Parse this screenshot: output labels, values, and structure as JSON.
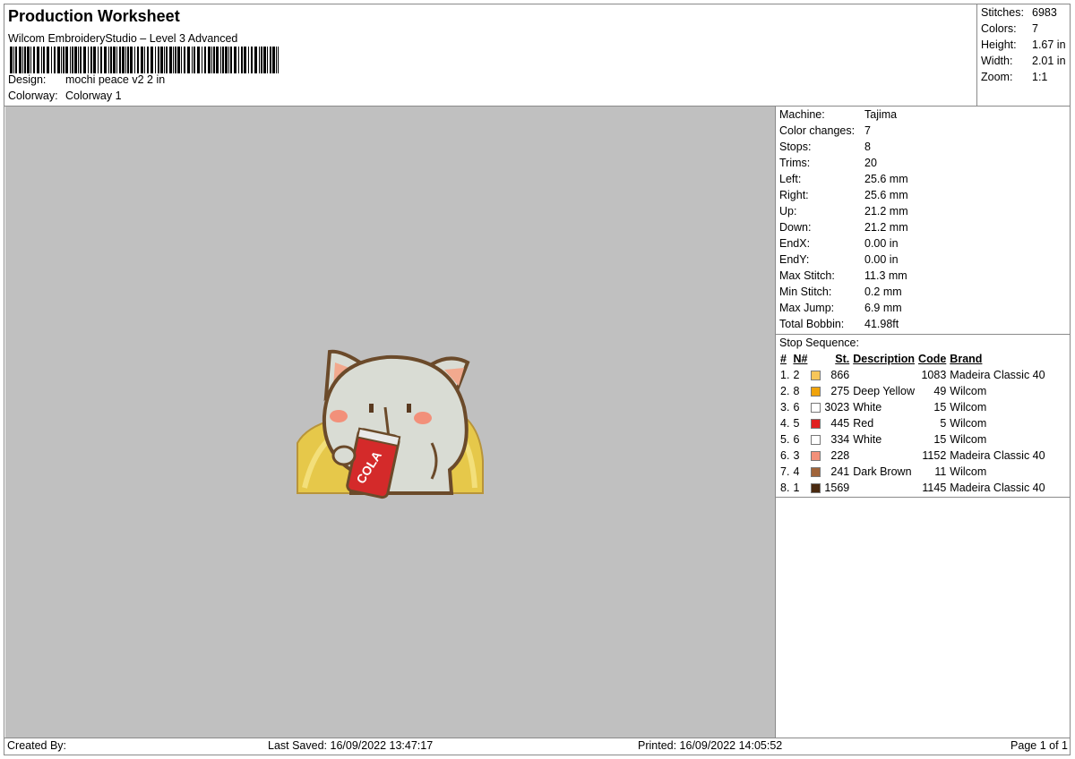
{
  "header": {
    "title": "Production Worksheet",
    "software": "Wilcom EmbroideryStudio – Level 3 Advanced",
    "design_label": "Design:",
    "design_value": "mochi peace v2 2 in",
    "colorway_label": "Colorway:",
    "colorway_value": "Colorway 1"
  },
  "stats": [
    {
      "label": "Stitches:",
      "value": "6983"
    },
    {
      "label": "Colors:",
      "value": "7"
    },
    {
      "label": "Height:",
      "value": "1.67 in"
    },
    {
      "label": "Width:",
      "value": "2.01 in"
    },
    {
      "label": "Zoom:",
      "value": "1:1"
    }
  ],
  "machine": [
    {
      "label": "Machine:",
      "value": "Tajima"
    },
    {
      "label": "Color changes:",
      "value": "7"
    },
    {
      "label": "Stops:",
      "value": "8"
    },
    {
      "label": "Trims:",
      "value": "20"
    },
    {
      "label": "Left:",
      "value": "25.6 mm"
    },
    {
      "label": "Right:",
      "value": "25.6 mm"
    },
    {
      "label": "Up:",
      "value": "21.2 mm"
    },
    {
      "label": "Down:",
      "value": "21.2 mm"
    },
    {
      "label": "EndX:",
      "value": "0.00 in"
    },
    {
      "label": "EndY:",
      "value": "0.00 in"
    },
    {
      "label": "Max Stitch:",
      "value": "11.3 mm"
    },
    {
      "label": "Min Stitch:",
      "value": "0.2 mm"
    },
    {
      "label": "Max Jump:",
      "value": "6.9 mm"
    },
    {
      "label": "Total Bobbin:",
      "value": "41.98ft"
    }
  ],
  "stop_sequence": {
    "title": "Stop Sequence:",
    "headers": {
      "num": "#",
      "n": "N#",
      "st": "St.",
      "desc": "Description",
      "code": "Code",
      "brand": "Brand"
    },
    "rows": [
      {
        "num": "1.",
        "n": "2",
        "color": "#f7c65a",
        "st": "866",
        "desc": "",
        "code": "1083",
        "brand": "Madeira Classic 40"
      },
      {
        "num": "2.",
        "n": "8",
        "color": "#f0a30a",
        "st": "275",
        "desc": "Deep Yellow",
        "code": "49",
        "brand": "Wilcom"
      },
      {
        "num": "3.",
        "n": "6",
        "color": "#ffffff",
        "st": "3023",
        "desc": "White",
        "code": "15",
        "brand": "Wilcom"
      },
      {
        "num": "4.",
        "n": "5",
        "color": "#e02020",
        "st": "445",
        "desc": "Red",
        "code": "5",
        "brand": "Wilcom"
      },
      {
        "num": "5.",
        "n": "6",
        "color": "#ffffff",
        "st": "334",
        "desc": "White",
        "code": "15",
        "brand": "Wilcom"
      },
      {
        "num": "6.",
        "n": "3",
        "color": "#f2907a",
        "st": "228",
        "desc": "",
        "code": "1152",
        "brand": "Madeira Classic 40"
      },
      {
        "num": "7.",
        "n": "4",
        "color": "#a0643a",
        "st": "241",
        "desc": "Dark Brown",
        "code": "11",
        "brand": "Wilcom"
      },
      {
        "num": "8.",
        "n": "1",
        "color": "#4a2a10",
        "st": "1569",
        "desc": "",
        "code": "1145",
        "brand": "Madeira Classic 40"
      }
    ]
  },
  "design_image": {
    "can_text": "COLA"
  },
  "footer": {
    "created_by": "Created By:",
    "last_saved": "Last Saved: 16/09/2022 13:47:17",
    "printed": "Printed: 16/09/2022 14:05:52",
    "page": "Page 1 of 1"
  }
}
